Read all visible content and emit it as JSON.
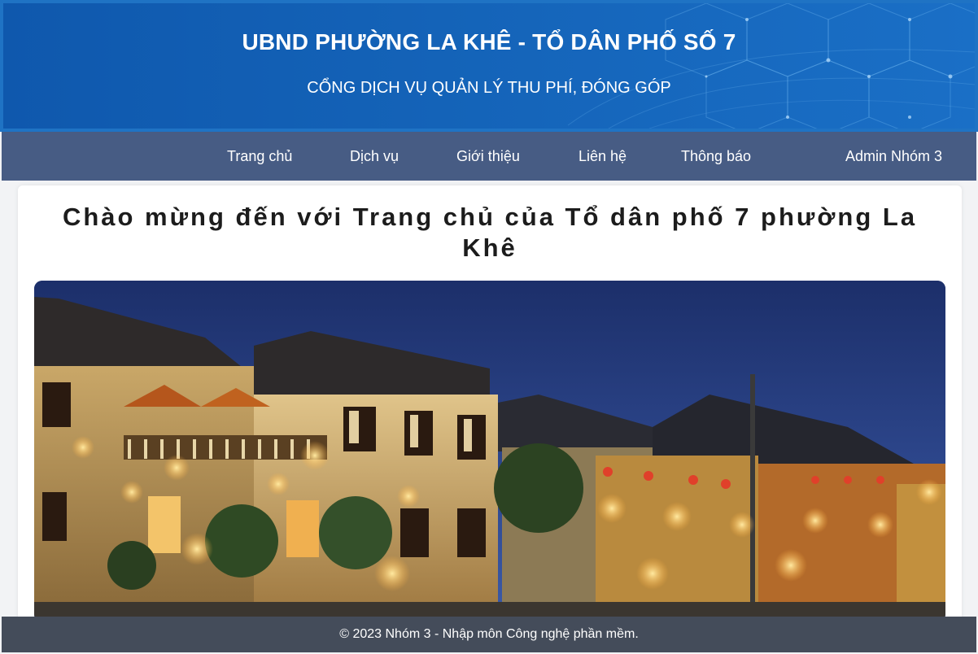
{
  "header": {
    "title": "UBND PHƯỜNG LA KHÊ - TỔ DÂN PHỐ SỐ 7",
    "subtitle": "CỔNG DỊCH VỤ QUẢN LÝ THU PHÍ, ĐÓNG GÓP"
  },
  "nav": {
    "items": [
      {
        "label": "Trang chủ"
      },
      {
        "label": "Dịch vụ"
      },
      {
        "label": "Giới thiệu"
      },
      {
        "label": "Liên hệ"
      },
      {
        "label": "Thông báo"
      }
    ],
    "account": "Admin Nhóm 3"
  },
  "main": {
    "heading_line1": "Chào mừng đến với Trang chủ của Tổ dân phố 7 phường La",
    "heading_line2": "Khê",
    "image_subject": "night-street-old-town-photo"
  },
  "footer": {
    "text": "© 2023 Nhóm 3 - Nhập môn Công nghệ phần mềm."
  },
  "colors": {
    "banner": "#1463b8",
    "navbar": "#475c84",
    "footer": "#444c5a"
  }
}
